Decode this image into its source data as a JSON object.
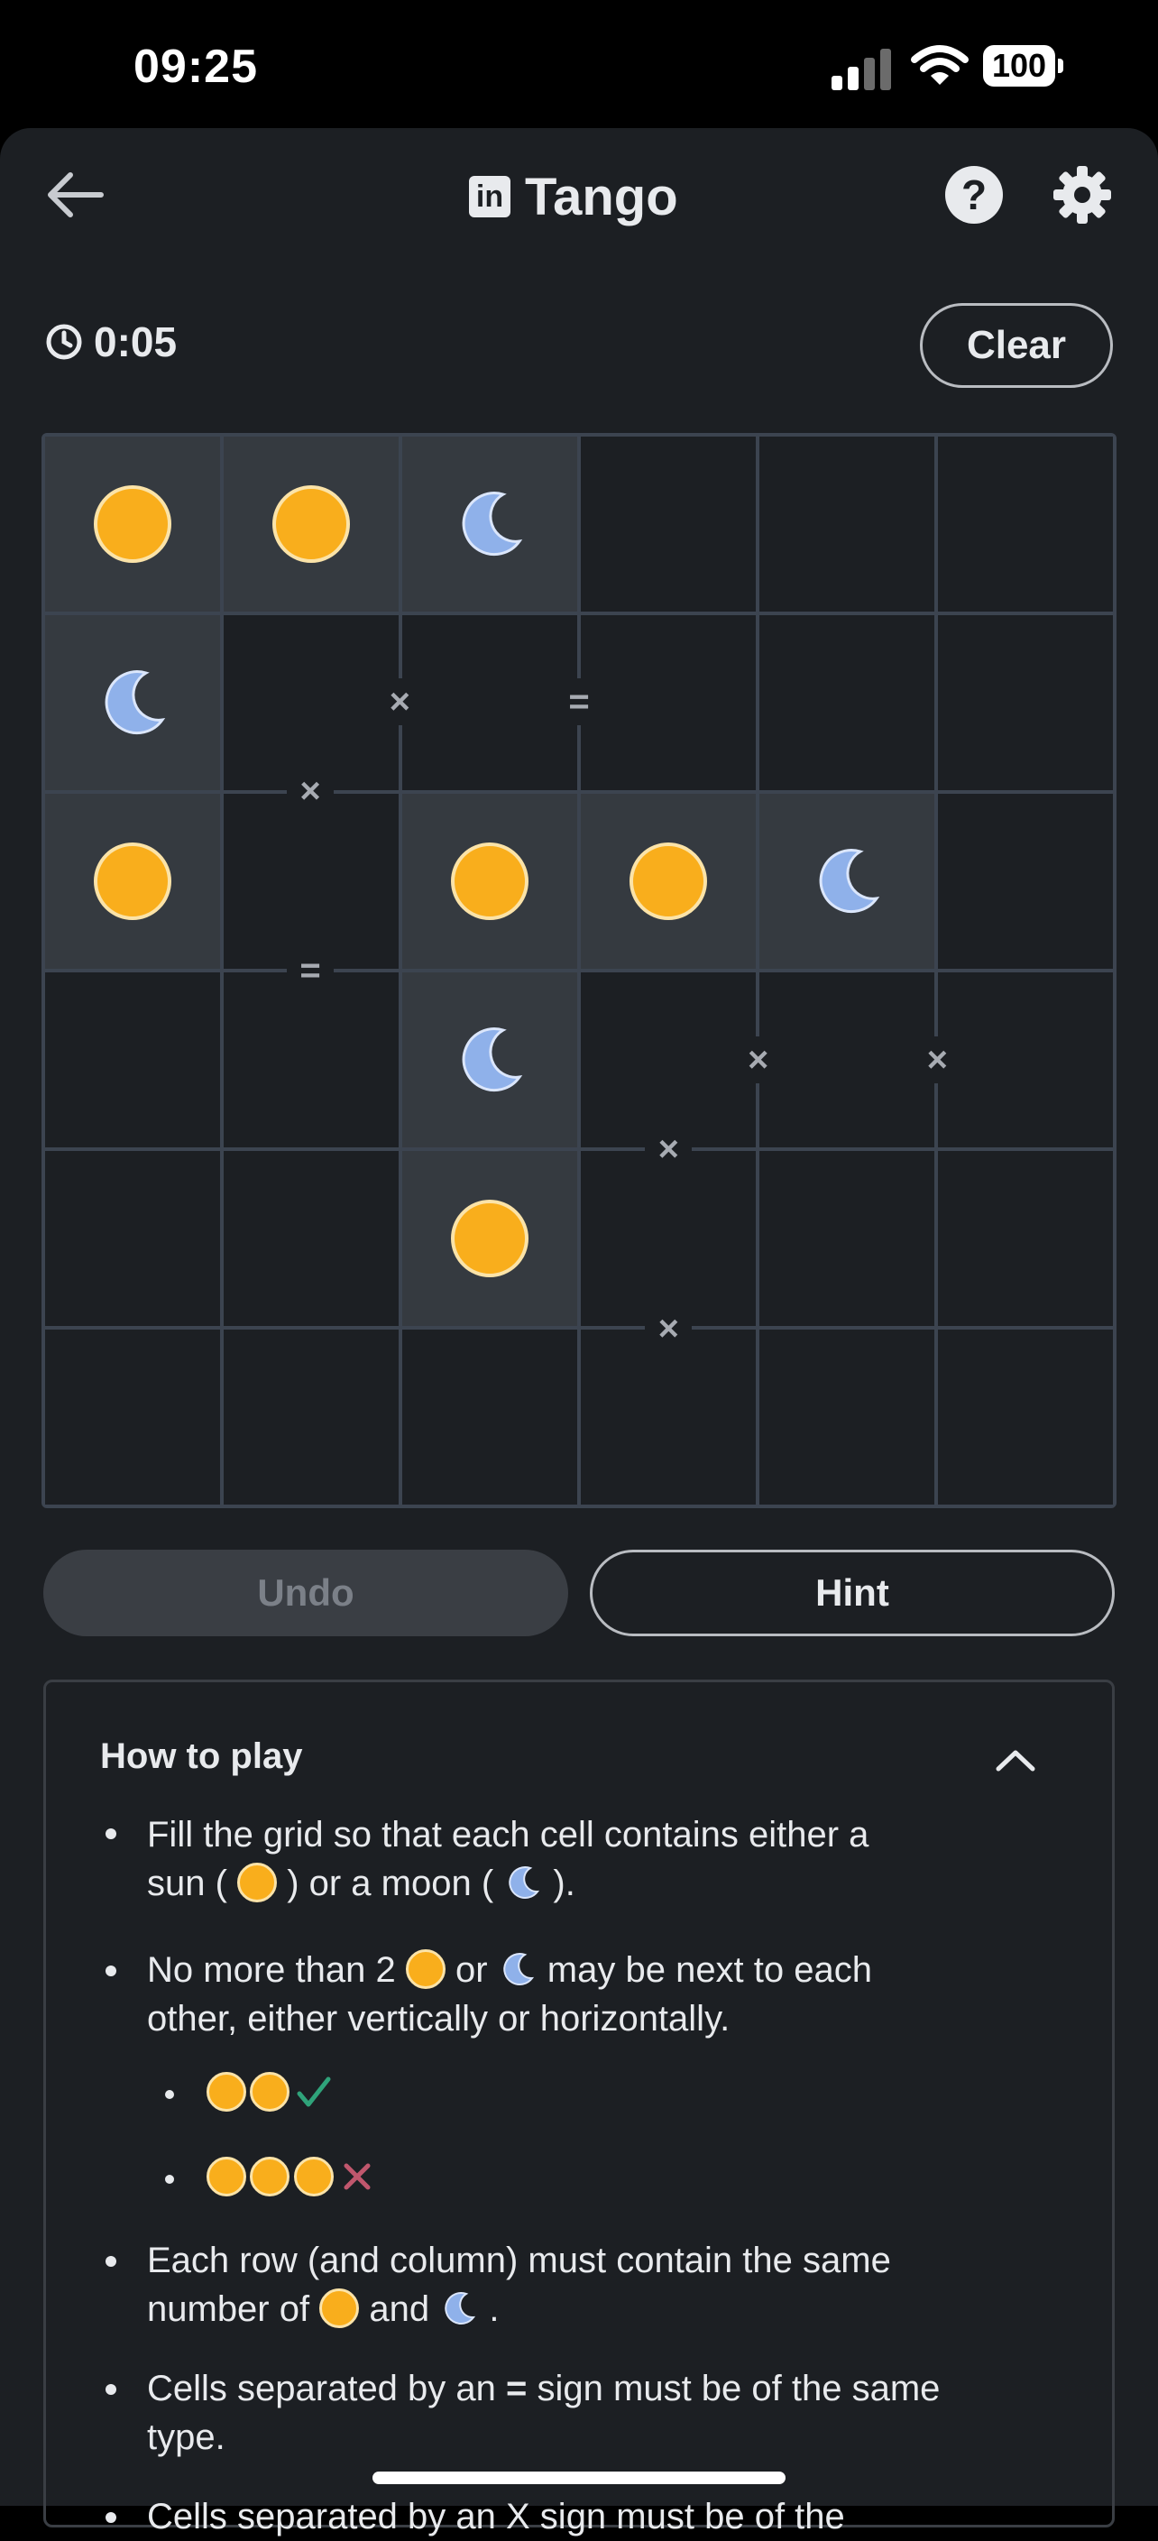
{
  "status_bar": {
    "time": "09:25",
    "battery": "100"
  },
  "header": {
    "title": "Tango",
    "logo_text": "in",
    "help_label": "?"
  },
  "timer": "0:05",
  "clear_label": "Clear",
  "grid": {
    "rows": [
      [
        {
          "v": "sun",
          "locked": true
        },
        {
          "v": "sun",
          "locked": true
        },
        {
          "v": "moon",
          "locked": true
        },
        {
          "v": "",
          "locked": false
        },
        {
          "v": "",
          "locked": false
        },
        {
          "v": "",
          "locked": false
        }
      ],
      [
        {
          "v": "moon",
          "locked": true
        },
        {
          "v": "",
          "locked": false
        },
        {
          "v": "",
          "locked": false
        },
        {
          "v": "",
          "locked": false
        },
        {
          "v": "",
          "locked": false
        },
        {
          "v": "",
          "locked": false
        }
      ],
      [
        {
          "v": "sun",
          "locked": true
        },
        {
          "v": "",
          "locked": false
        },
        {
          "v": "sun",
          "locked": true
        },
        {
          "v": "sun",
          "locked": true
        },
        {
          "v": "moon",
          "locked": true
        },
        {
          "v": "",
          "locked": false
        }
      ],
      [
        {
          "v": "",
          "locked": false
        },
        {
          "v": "",
          "locked": false
        },
        {
          "v": "moon",
          "locked": true
        },
        {
          "v": "",
          "locked": false
        },
        {
          "v": "",
          "locked": false
        },
        {
          "v": "",
          "locked": false
        }
      ],
      [
        {
          "v": "",
          "locked": false
        },
        {
          "v": "",
          "locked": false
        },
        {
          "v": "sun",
          "locked": true
        },
        {
          "v": "",
          "locked": false
        },
        {
          "v": "",
          "locked": false
        },
        {
          "v": "",
          "locked": false
        }
      ],
      [
        {
          "v": "",
          "locked": false
        },
        {
          "v": "",
          "locked": false
        },
        {
          "v": "",
          "locked": false
        },
        {
          "v": "",
          "locked": false
        },
        {
          "v": "",
          "locked": false
        },
        {
          "v": "",
          "locked": false
        }
      ]
    ],
    "constraints": [
      {
        "between": "r1c1-r1c2",
        "sign": "×"
      },
      {
        "between": "r1c2-r1c3",
        "sign": "="
      },
      {
        "between": "r1c1-r2c1",
        "sign": "×"
      },
      {
        "between": "r2c1-r3c1",
        "sign": "="
      },
      {
        "between": "r3c3-r3c4",
        "sign": "×"
      },
      {
        "between": "r3c4-r3c5",
        "sign": "×"
      },
      {
        "between": "r3c3-r4c3",
        "sign": "×"
      },
      {
        "between": "r4c3-r5c3",
        "sign": "×"
      }
    ]
  },
  "buttons": {
    "undo": "Undo",
    "hint": "Hint"
  },
  "how_to_play": {
    "title": "How to play",
    "rule1_a": "Fill the grid so that each cell contains either a",
    "rule1_b": "sun (",
    "rule1_c": ") or a moon (",
    "rule1_d": ").",
    "rule2_a": "No more than 2",
    "rule2_b": "or",
    "rule2_c": "may be next to each",
    "rule2_d": "other, either vertically or horizontally.",
    "rule3_a": "Each row (and column) must contain the same",
    "rule3_b": "number of",
    "rule3_c": "and",
    "rule3_d": ".",
    "rule4_a": "Cells separated by an",
    "rule4_sign": "=",
    "rule4_b": "sign must be of the same",
    "rule4_c": "type.",
    "rule5_a": "Cells separated by an X sign must be of the"
  },
  "colors": {
    "sun": "#f9ae1c",
    "moon": "#8fb1ea",
    "check": "#2fa37a",
    "cross": "#c0576d"
  }
}
